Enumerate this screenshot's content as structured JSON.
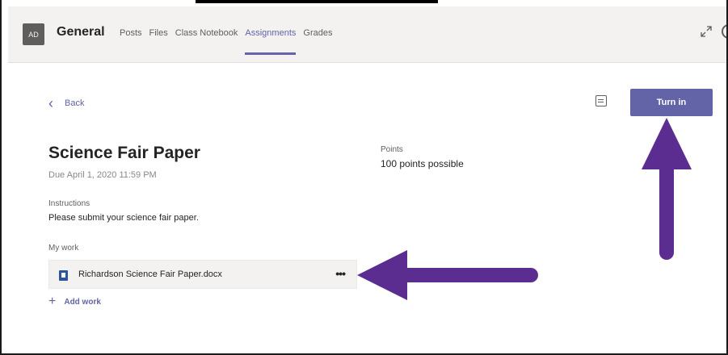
{
  "header": {
    "avatar_initials": "AD",
    "team_name": "General",
    "tabs": [
      {
        "label": "Posts"
      },
      {
        "label": "Files"
      },
      {
        "label": "Class Notebook"
      },
      {
        "label": "Assignments",
        "active": true
      },
      {
        "label": "Grades"
      }
    ]
  },
  "assignment": {
    "back_label": "Back",
    "title": "Science Fair Paper",
    "due": "Due April 1, 2020 11:59 PM",
    "points_label": "Points",
    "points_value": "100 points possible",
    "instructions_label": "Instructions",
    "instructions_text": "Please submit your science fair paper.",
    "my_work_label": "My work",
    "file_name": "Richardson Science Fair Paper.docx",
    "more_label": "•••",
    "add_work_label": "Add work",
    "turn_in_label": "Turn in"
  },
  "colors": {
    "accent": "#6264a7",
    "arrow": "#5c2d91",
    "header_bg": "#f3f2f1",
    "text": "#252423"
  },
  "icons": [
    "back-chevron-icon",
    "expand-icon",
    "refresh-icon",
    "immersive-reader-icon",
    "word-file-icon",
    "more-options-icon",
    "plus-icon",
    "arrow-up-annotation",
    "arrow-left-annotation"
  ]
}
